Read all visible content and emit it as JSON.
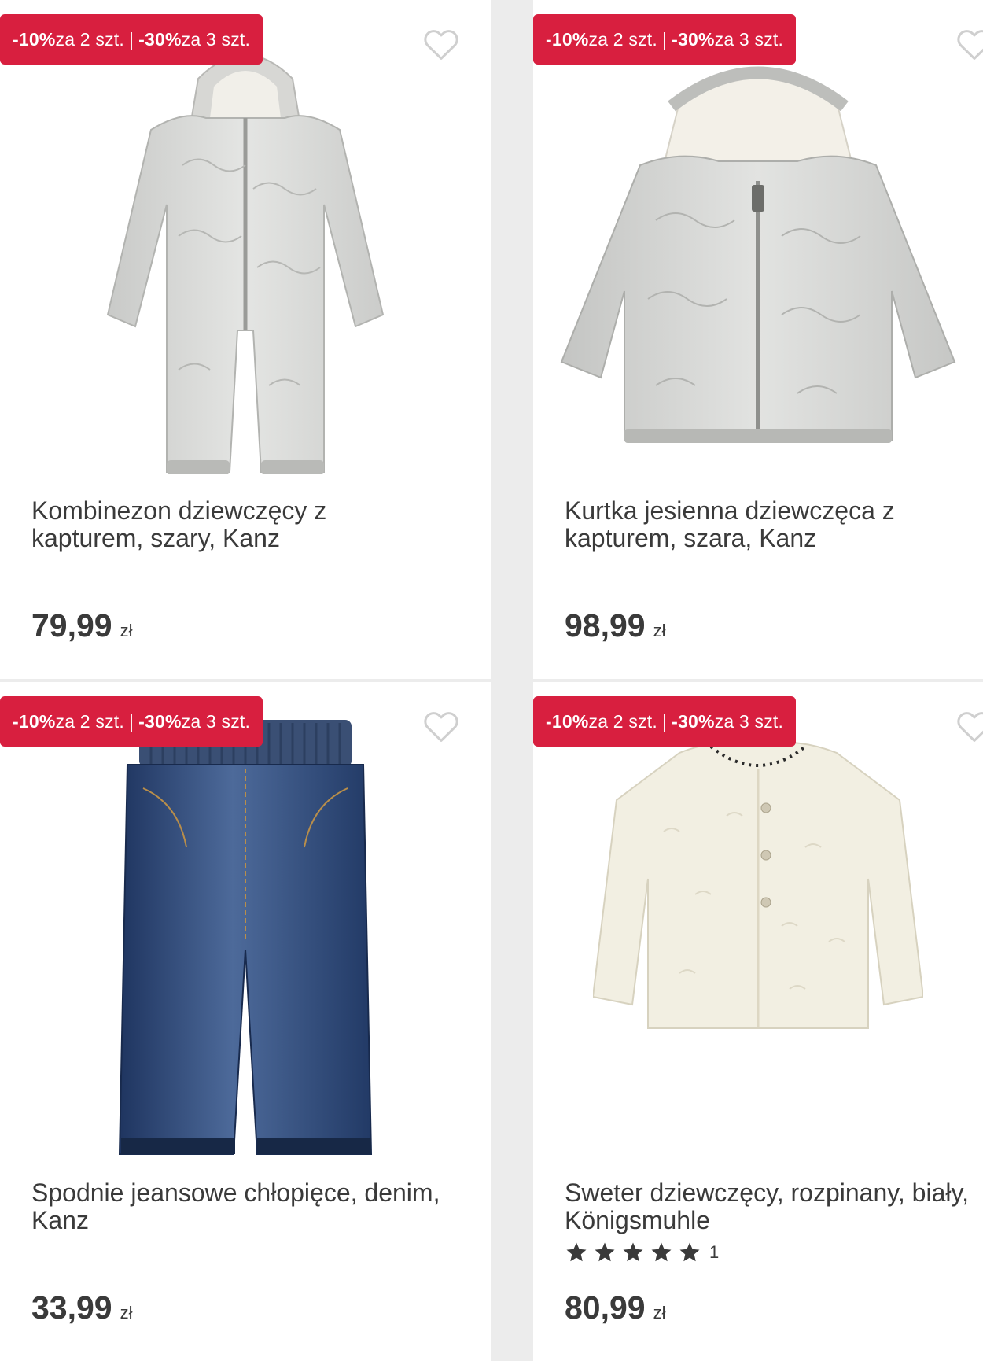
{
  "colors": {
    "promo_bg": "#d81f3f",
    "text": "#3a3a3a",
    "heart_stroke": "#cfcfcf",
    "star": "#3a3a3a"
  },
  "products": [
    {
      "promo": {
        "part1_bold": "-10%",
        "part1_text": " za 2 szt.",
        "separator": "|",
        "part2_bold": "-30%",
        "part2_text": " za 3 szt."
      },
      "title": "Kombinezon dziewczęcy z kapturem, szary, Kanz",
      "price": "79,99",
      "currency": "zł",
      "image": "grey-quilted-hooded-snowsuit",
      "favorite_icon": "heart-outline-icon"
    },
    {
      "promo": {
        "part1_bold": "-10%",
        "part1_text": " za 2 szt.",
        "separator": "|",
        "part2_bold": "-30%",
        "part2_text": " za 3 szt."
      },
      "title": "Kurtka jesienna dziewczęca z kapturem, szara, Kanz",
      "price": "98,99",
      "currency": "zł",
      "image": "grey-quilted-hooded-jacket",
      "favorite_icon": "heart-outline-icon"
    },
    {
      "promo": {
        "part1_bold": "-10%",
        "part1_text": " za 2 szt.",
        "separator": "|",
        "part2_bold": "-30%",
        "part2_text": " za 3 szt."
      },
      "title": "Spodnie jeansowe chłopięce, denim, Kanz",
      "price": "33,99",
      "currency": "zł",
      "image": "blue-denim-jeans",
      "favorite_icon": "heart-outline-icon"
    },
    {
      "promo": {
        "part1_bold": "-10%",
        "part1_text": " za 2 szt.",
        "separator": "|",
        "part2_bold": "-30%",
        "part2_text": " za 3 szt."
      },
      "title": "Sweter dziewczęcy, rozpinany, biały, Königsmuhle",
      "price": "80,99",
      "currency": "zł",
      "image": "cream-fleece-cardigan",
      "favorite_icon": "heart-outline-icon",
      "rating": {
        "stars": 5,
        "count": "1"
      }
    }
  ]
}
